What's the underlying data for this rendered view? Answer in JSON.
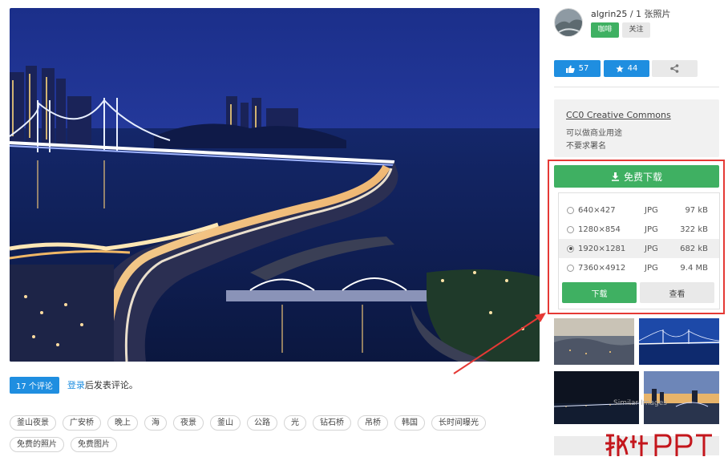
{
  "author": {
    "name": "algrin25",
    "photo_count": " / 1 张照片",
    "coffee_label": "咖啡",
    "follow_label": "关注"
  },
  "stats": {
    "likes": "57",
    "favorites": "44"
  },
  "license": {
    "title": "CC0 Creative Commons",
    "line1": "可以做商业用途",
    "line2": "不要求署名"
  },
  "download": {
    "main_label": "免费下载",
    "sizes": [
      {
        "dim": "640×427",
        "format": "JPG",
        "size": "97 kB",
        "selected": false
      },
      {
        "dim": "1280×854",
        "format": "JPG",
        "size": "322 kB",
        "selected": false
      },
      {
        "dim": "1920×1281",
        "format": "JPG",
        "size": "682 kB",
        "selected": true
      },
      {
        "dim": "7360×4912",
        "format": "JPG",
        "size": "9.4 MB",
        "selected": false
      }
    ],
    "download_button": "下载",
    "view_button": "查看"
  },
  "comments": {
    "count_badge": "17 个评论",
    "login_link": "登录",
    "login_suffix": "后发表评论。"
  },
  "tags": [
    "釜山夜景",
    "广安桥",
    "晚上",
    "海",
    "夜景",
    "釜山",
    "公路",
    "光",
    "钻石桥",
    "吊桥",
    "韩国",
    "长时间曝光",
    "免费的照片",
    "免费图片"
  ],
  "similar_label": "Similar Images",
  "watermark": {
    "text": "秋叶PPT"
  },
  "colors": {
    "green": "#3fb062",
    "blue": "#1f8ee0",
    "red_annotation": "#e53935"
  }
}
